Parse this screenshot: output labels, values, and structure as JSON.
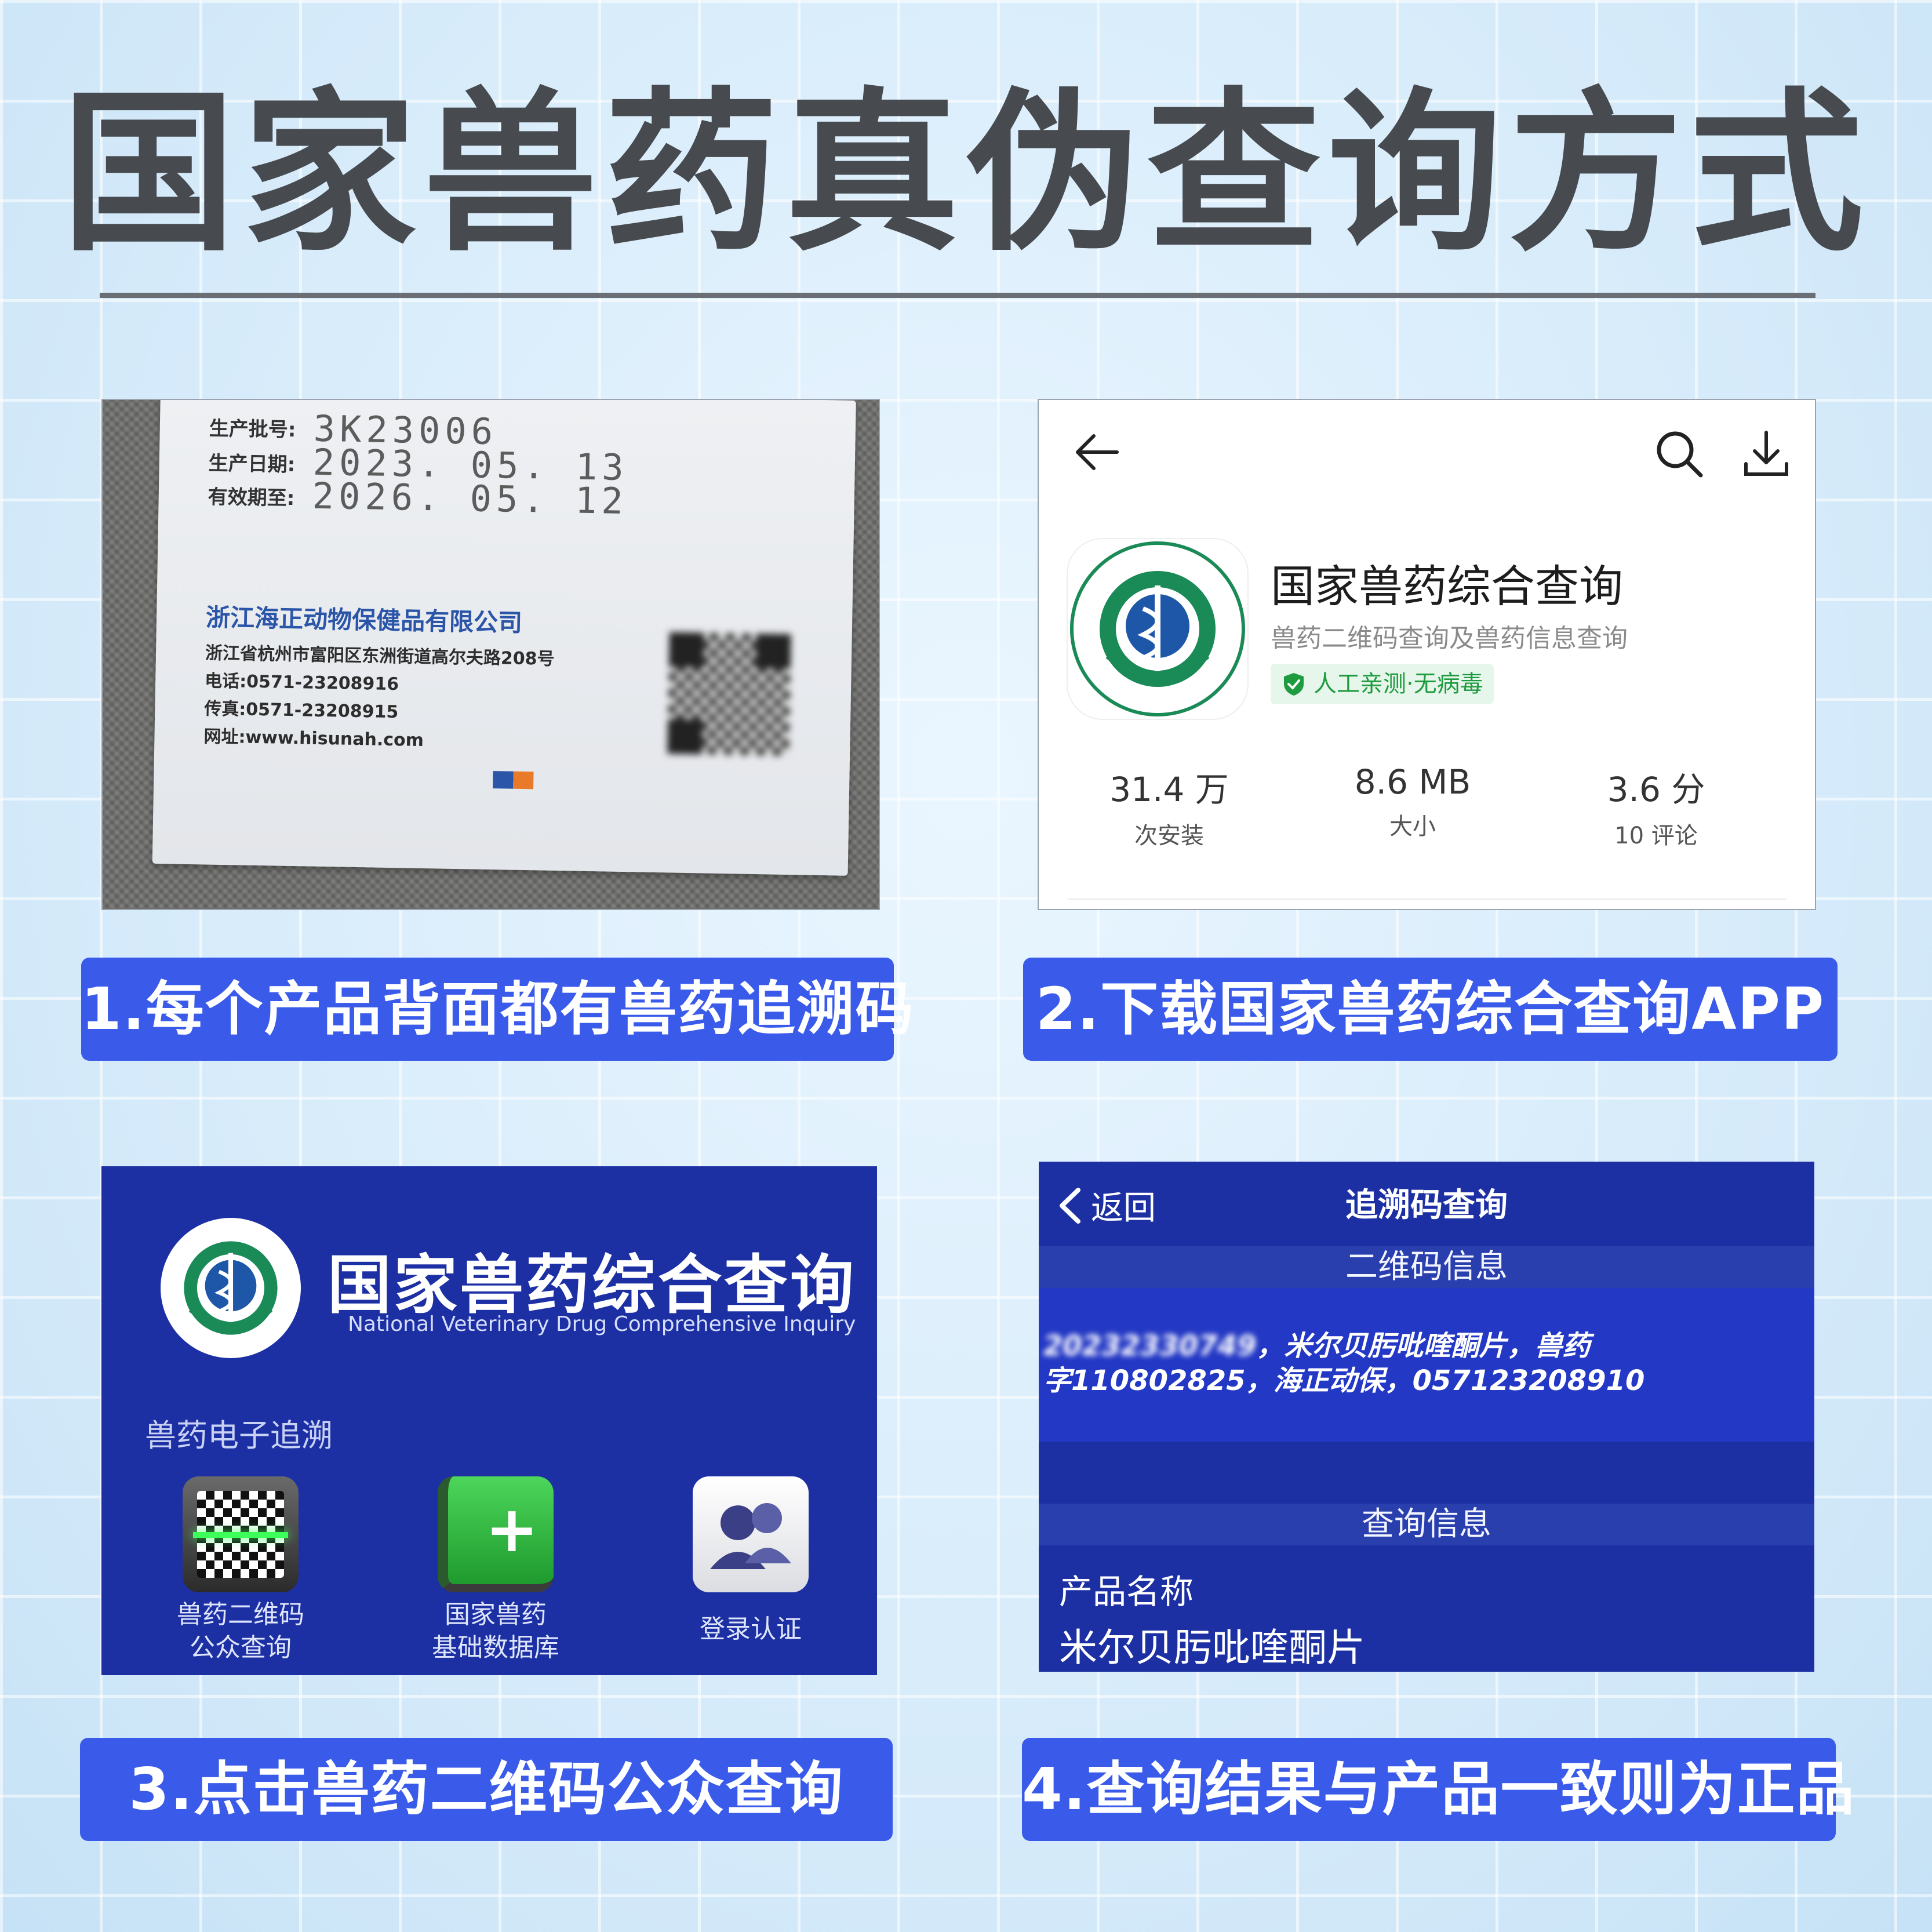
{
  "page": {
    "title": "国家兽药真伪查询方式"
  },
  "steps": [
    {
      "label": "1.每个产品背面都有兽药追溯码"
    },
    {
      "label": "2.下载国家兽药综合查询APP"
    },
    {
      "label": "3.点击兽药二维码公众查询"
    },
    {
      "label": "4.查询结果与产品一致则为正品"
    }
  ],
  "photo": {
    "batch_label": "生产批号:",
    "batch_value": "3K23006",
    "mfg_label": "生产日期:",
    "mfg_value": "2023. 05. 13",
    "exp_label": "有效期至:",
    "exp_value": "2026. 05. 12",
    "company": "浙江海正动物保健品有限公司",
    "address": "浙江省杭州市富阳区东洲街道高尔夫路208号",
    "phone": "电话:0571-23208916",
    "fax": "传真:0571-23208915",
    "website": "网址:www.hisunah.com"
  },
  "store": {
    "app_name": "国家兽药综合查询",
    "app_desc": "兽药二维码查询及兽药信息查询",
    "badge": "人工亲测·无病毒",
    "stats": [
      {
        "value": "31.4 万",
        "label": "次安装"
      },
      {
        "value": "8.6 MB",
        "label": "大小"
      },
      {
        "value": "3.6 分",
        "label": "10 评论"
      }
    ],
    "icons": {
      "back": "arrow-left-icon",
      "search": "search-icon",
      "download": "download-icon"
    }
  },
  "home": {
    "title": "国家兽药综合查询",
    "subtitle": "National Veterinary Drug Comprehensive Inquiry",
    "section": "兽药电子追溯",
    "items": [
      {
        "label_line1": "兽药二维码",
        "label_line2": "公众查询",
        "icon": "qr-scan-icon"
      },
      {
        "label_line1": "国家兽药",
        "label_line2": "基础数据库",
        "icon": "database-book-icon"
      },
      {
        "label_line1": "登录认证",
        "label_line2": "",
        "icon": "users-icon"
      }
    ]
  },
  "result": {
    "back_label": "返回",
    "header_title": "追溯码查询",
    "qr_section": "二维码信息",
    "code_obscured": "20232330749",
    "line1_rest": "，米尔贝肟吡喹酮片，兽药",
    "line2": "字110802825，海正动保，057123208910",
    "query_section": "查询信息",
    "product_name_label": "产品名称",
    "product_name_value": "米尔贝肟吡喹酮片"
  },
  "colors": {
    "accent": "#3a5bea",
    "app_blue": "#1c30a4",
    "title_gray": "#474b50",
    "badge_green": "#1e9a3f"
  }
}
